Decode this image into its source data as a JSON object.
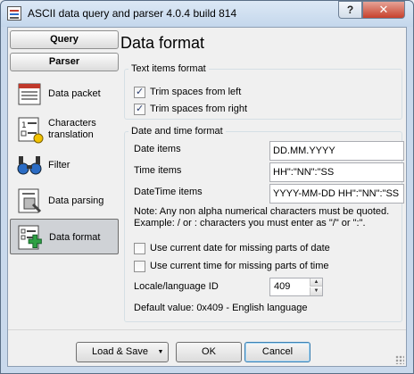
{
  "window": {
    "title": "ASCII data query and parser 4.0.4 build 814",
    "help_label": "?",
    "close_label": "✕"
  },
  "sidebar": {
    "groups": [
      {
        "label": "Query"
      },
      {
        "label": "Parser"
      }
    ],
    "items": [
      {
        "label": "Data packet",
        "icon": "data-packet-icon"
      },
      {
        "label": "Characters translation",
        "icon": "characters-translation-icon"
      },
      {
        "label": "Filter",
        "icon": "filter-icon"
      },
      {
        "label": "Data parsing",
        "icon": "data-parsing-icon"
      },
      {
        "label": "Data format",
        "icon": "data-format-icon",
        "selected": true
      }
    ]
  },
  "main": {
    "title": "Data format",
    "text_items": {
      "label": "Text items format",
      "trim_left": {
        "label": "Trim spaces from left",
        "checked": true
      },
      "trim_right": {
        "label": "Trim spaces from right",
        "checked": true
      }
    },
    "datetime": {
      "label": "Date and time format",
      "date_items": {
        "label": "Date items",
        "value": "DD.MM.YYYY"
      },
      "time_items": {
        "label": "Time items",
        "value": "HH\":\"NN\":\"SS"
      },
      "datetime_items": {
        "label": "DateTime items",
        "value": "YYYY-MM-DD HH\":\"NN\":\"SS"
      },
      "note_line1": "Note: Any non alpha numerical characters must be quoted.",
      "note_line2": "Example: / or : characters you must enter as \"/\" or \":\".",
      "use_current_date": {
        "label": "Use current date for missing parts of date",
        "checked": false
      },
      "use_current_time": {
        "label": "Use current time for missing parts of time",
        "checked": false
      },
      "locale": {
        "label": "Locale/language ID",
        "value": "409"
      },
      "default_value": "Default value: 0x409 - English language"
    }
  },
  "footer": {
    "load_save": "Load & Save",
    "ok": "OK",
    "cancel": "Cancel"
  }
}
